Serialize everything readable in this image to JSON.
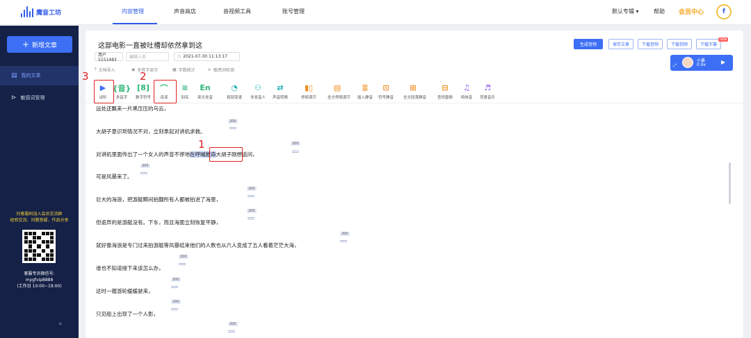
{
  "brand": {
    "name": "魔音工坊"
  },
  "nav": {
    "items": [
      {
        "label": "内容管理"
      },
      {
        "label": "声音商店"
      },
      {
        "label": "音视频工具"
      },
      {
        "label": "账号管理"
      }
    ],
    "active_index": 0
  },
  "top_right": {
    "album": "默认专辑 ▾",
    "help": "帮助",
    "vip": "会员中心",
    "avatar_letter": "f"
  },
  "sidebar": {
    "new_article": "新增文章",
    "items": [
      {
        "label": "我的文章",
        "icon": "document-icon"
      },
      {
        "label": "敏感词管理",
        "icon": "filter-icon"
      }
    ],
    "promo_line1": "扫客服码加入会员交流群",
    "promo_line2": "经验交流、问题答疑、作品分享",
    "service_line1": "客服专员微信号:",
    "service_line2": "mygfvip8888",
    "service_line3": "(工作日 10:00~19:00)",
    "collapse": "«"
  },
  "editor": {
    "title": "这部电影一直被吐槽却依然拿到这",
    "user_id": "用户5151483",
    "editor_placeholder": "编辑人员",
    "datetime": "2021-07-30 11:13:17",
    "meta": [
      {
        "label": "文档导入",
        "icon": "import-icon"
      },
      {
        "label": "多音字显示",
        "icon": "eye-icon"
      },
      {
        "label": "字数统计",
        "icon": "count-icon"
      },
      {
        "label": "敏感词检测",
        "icon": "scan-icon"
      }
    ],
    "actions": {
      "generate": "生成音频",
      "save": "保存文章",
      "download_audio": "下载音频",
      "download_video": "下载视频",
      "download_subtitle": "下载字幕",
      "new_badge": "new"
    },
    "voice": {
      "name": "小暴",
      "speed": "0.9x"
    }
  },
  "toolbar": [
    {
      "label": "试听",
      "icon": "play-icon",
      "glyph": "▶"
    },
    {
      "label": "多音字",
      "icon": "polyphone-icon",
      "glyph": "{音}"
    },
    {
      "label": "数字符号",
      "icon": "number-icon",
      "glyph": "[8]"
    },
    {
      "label": "连读",
      "icon": "liaison-icon",
      "glyph": "⌒"
    },
    {
      "label": "别名",
      "icon": "alias-icon",
      "glyph": "≡"
    },
    {
      "label": "英文发音",
      "icon": "english-icon",
      "glyph": "En"
    },
    {
      "label": "局部变速",
      "icon": "speed-icon",
      "glyph": "◔"
    },
    {
      "label": "多发音人",
      "icon": "multi-speaker-icon",
      "glyph": "⚇"
    },
    {
      "label": "声音转换",
      "icon": "voice-convert-icon",
      "glyph": "⇄"
    },
    {
      "label": "停顿调节",
      "icon": "pause-adjust-icon",
      "glyph": "▮▯"
    },
    {
      "label": "全文停顿调节",
      "icon": "full-pause-icon",
      "glyph": "▤"
    },
    {
      "label": "插入静音",
      "icon": "insert-silence-icon",
      "glyph": "≣"
    },
    {
      "label": "符号静音",
      "icon": "symbol-silence-icon",
      "glyph": "⊡"
    },
    {
      "label": "全文段落静音",
      "icon": "paragraph-silence-icon",
      "glyph": "⊞"
    },
    {
      "label": "查找替换",
      "icon": "find-replace-icon",
      "glyph": "⊟"
    },
    {
      "label": "特效音",
      "icon": "effect-icon",
      "glyph": "♫"
    },
    {
      "label": "背景音乐",
      "icon": "bgm-icon",
      "glyph": "♬"
    }
  ],
  "body": {
    "pause_value": "200",
    "paragraphs": [
      {
        "text": "远处还飘来一片黑压压的乌云，"
      },
      {
        "text": "大胡子意识到情况不对，立刻拿起对讲机求救。"
      },
      {
        "before": "对讲机里面传出了一个女人的声音不停地",
        "highlight": "在呼喊救命",
        "after": "大胡子刚想追问，"
      },
      {
        "text": "可是风暴来了。"
      },
      {
        "text": "巨大的海浪，把游艇瞬间拍翻所有人都被拍进了海里，"
      },
      {
        "text": "但诡异的是游艇没有。下车，而且海面立刻恢复平静，"
      },
      {
        "text": "就好像海浪是专门过来拍游艇等风暴结束他们的人数也从六人变成了五人看着茫茫大海，"
      },
      {
        "text": "谁也不知道接下来该怎么办，"
      },
      {
        "text": "这时一艘游轮缓缓驶来，"
      },
      {
        "text": "只见船上出现了一个人影，"
      }
    ]
  },
  "annotations": {
    "n1": "1",
    "n2": "2",
    "n3": "3"
  }
}
